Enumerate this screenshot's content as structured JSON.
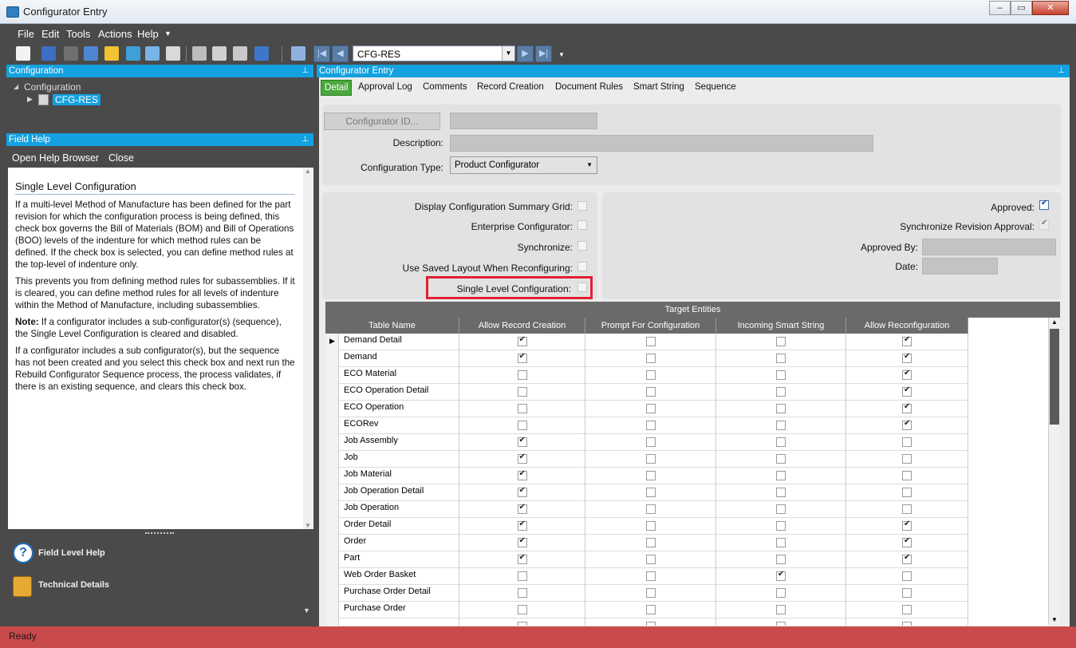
{
  "window": {
    "title": "Configurator Entry",
    "controls": [
      "minimize",
      "maximize",
      "close"
    ]
  },
  "menu": [
    "File",
    "Edit",
    "Tools",
    "Actions",
    "Help"
  ],
  "toolbar": {
    "record": "CFG-RES"
  },
  "config_panel": {
    "header": "Configuration",
    "tree_root": "Configuration",
    "tree_child": "CFG-RES"
  },
  "field_help": {
    "header": "Field Help",
    "open_help": "Open Help Browser",
    "close": "Close",
    "title": "Single Level Configuration",
    "p1": "If a multi-level Method of Manufacture has been defined for the part revision for which the configuration process is being defined, this check box governs the Bill of Materials (BOM) and Bill of Operations (BOO) levels of the indenture for which method rules can be defined. If the check box is selected, you can define method rules at the top-level of indenture only.",
    "p2": "This prevents you from defining method rules for subassemblies. If it is cleared, you can define method rules for all levels of indenture within the Method of Manufacture, including subassemblies.",
    "note_label": "Note:",
    "p3": " If a configurator includes a sub-configurator(s) (sequence), the Single Level Configuration is cleared and disabled.",
    "p4": "If a configurator includes a sub configurator(s), but the sequence has not been created and you select this check box and next run the Rebuild Configurator Sequence process, the process validates, if there is an existing sequence, and clears this check box.",
    "links": [
      "Field Level Help",
      "Technical Details"
    ]
  },
  "main": {
    "header": "Configurator Entry",
    "tabs": [
      "Detail",
      "Approval Log",
      "Comments",
      "Record Creation",
      "Document Rules",
      "Smart String",
      "Sequence"
    ],
    "configurator_id_btn": "Configurator ID...",
    "description_label": "Description:",
    "config_type_label": "Configuration Type:",
    "config_type_value": "Product Configurator",
    "options": {
      "display_summary": "Display Configuration Summary Grid:",
      "enterprise": "Enterprise Configurator:",
      "synchronize": "Synchronize:",
      "use_saved_layout": "Use Saved Layout When Reconfiguring:",
      "single_level": "Single Level Configuration:"
    },
    "approval": {
      "approved": "Approved:",
      "approved_checked": true,
      "sync_revision": "Synchronize Revision Approval:",
      "sync_revision_checked": true,
      "approved_by": "Approved By:",
      "date": "Date:"
    }
  },
  "grid": {
    "title": "Target Entities",
    "columns": [
      "Table Name",
      "Allow Record Creation",
      "Prompt For Configuration",
      "Incoming Smart String",
      "Allow Reconfiguration"
    ],
    "rows": [
      {
        "name": "Demand Detail",
        "vals": [
          1,
          0,
          0,
          1
        ]
      },
      {
        "name": "Demand",
        "vals": [
          1,
          0,
          0,
          1
        ]
      },
      {
        "name": "ECO Material",
        "vals": [
          0,
          0,
          0,
          1
        ]
      },
      {
        "name": "ECO Operation Detail",
        "vals": [
          0,
          0,
          0,
          1
        ]
      },
      {
        "name": "ECO Operation",
        "vals": [
          0,
          0,
          0,
          1
        ]
      },
      {
        "name": "ECORev",
        "vals": [
          0,
          0,
          0,
          1
        ]
      },
      {
        "name": "Job Assembly",
        "vals": [
          1,
          0,
          0,
          0
        ]
      },
      {
        "name": "Job",
        "vals": [
          1,
          0,
          0,
          0
        ]
      },
      {
        "name": "Job Material",
        "vals": [
          1,
          0,
          0,
          0
        ]
      },
      {
        "name": "Job Operation Detail",
        "vals": [
          1,
          0,
          0,
          0
        ]
      },
      {
        "name": "Job Operation",
        "vals": [
          1,
          0,
          0,
          0
        ]
      },
      {
        "name": "Order Detail",
        "vals": [
          1,
          0,
          0,
          1
        ]
      },
      {
        "name": "Order",
        "vals": [
          1,
          0,
          0,
          1
        ]
      },
      {
        "name": "Part",
        "vals": [
          1,
          0,
          0,
          1
        ]
      },
      {
        "name": "Web Order Basket",
        "vals": [
          0,
          0,
          1,
          0
        ]
      },
      {
        "name": "Purchase Order Detail",
        "vals": [
          0,
          0,
          0,
          0
        ]
      },
      {
        "name": "Purchase Order",
        "vals": [
          0,
          0,
          0,
          0
        ]
      },
      {
        "name": "",
        "vals": [
          0,
          0,
          0,
          0
        ]
      }
    ]
  },
  "status": "Ready"
}
